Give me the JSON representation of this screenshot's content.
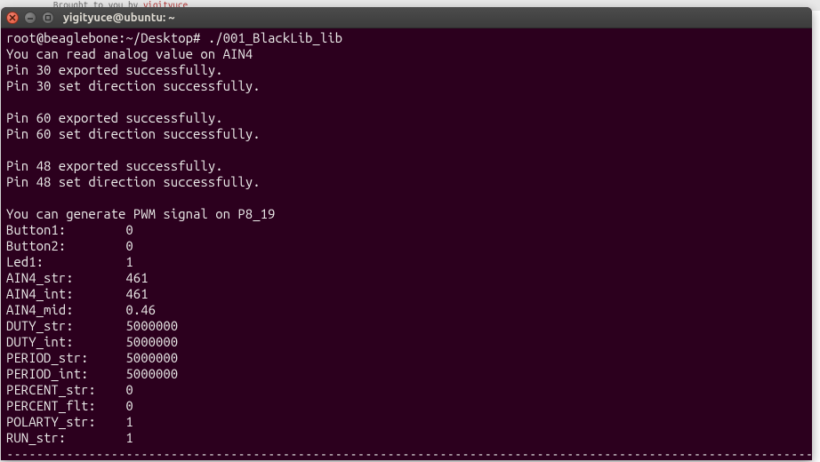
{
  "desktop": {
    "text_before": "Brought to you by ",
    "link_text": "yigityuce"
  },
  "window": {
    "title": "yigityuce@ubuntu: ~"
  },
  "terminal": {
    "prompt": "root@beaglebone:~/Desktop# ",
    "command": "./001_BlackLib_lib",
    "lines": [
      "You can read analog value on AIN4",
      "Pin 30 exported successfully.",
      "Pin 30 set direction successfully.",
      "",
      "Pin 60 exported successfully.",
      "Pin 60 set direction successfully.",
      "",
      "Pin 48 exported successfully.",
      "Pin 48 set direction successfully.",
      "",
      "You can generate PWM signal on P8_19",
      "Button1:        0",
      "Button2:        0",
      "Led1:           1",
      "AIN4_str:       461",
      "AIN4_int:       461",
      "AIN4_mid:       0.46",
      "DUTY_str:       5000000",
      "DUTY_int:       5000000",
      "PERIOD_str:     5000000",
      "PERIOD_int:     5000000",
      "PERCENT_str:    0",
      "PERCENT_flt:    0",
      "POLARTY_str:    1",
      "RUN_str:        1",
      "---------------------------------------------------------------------------------------------------------------------"
    ]
  }
}
